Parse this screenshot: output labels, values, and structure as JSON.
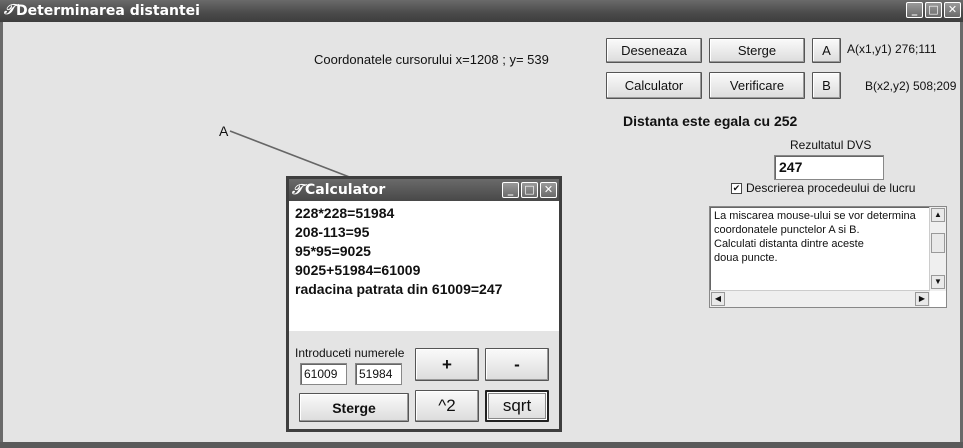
{
  "window": {
    "title": "Determinarea distantei"
  },
  "cursor_coords": "Coordonatele cursorului  x=1208 ; y= 539",
  "buttons": {
    "deseneaza": "Deseneaza",
    "sterge": "Sterge",
    "a": "A",
    "calculator": "Calculator",
    "verificare": "Verificare",
    "b": "B"
  },
  "points": {
    "a_label": "A(x1,y1) 276;111",
    "b_label": "B(x2,y2) 508;209",
    "canvas_a": "A"
  },
  "result": {
    "distance_text": "Distanta este egala cu 252",
    "dvs_label": "Rezultatul DVS",
    "dvs_value": "247"
  },
  "procedure": {
    "checkbox_label": "Descrierea procedeului de lucru",
    "checked": true,
    "lines": [
      "La miscarea mouse-ului se vor determina",
      "coordonatele punctelor A si B.",
      "Calculati distanta dintre aceste",
      "doua puncte."
    ]
  },
  "calculator": {
    "title": "Calculator",
    "output_lines": [
      "228*228=51984",
      "208-113=95",
      "95*95=9025",
      "9025+51984=61009",
      "radacina patrata din 61009=247"
    ],
    "input_label": "Introduceti numerele",
    "input1": "61009",
    "input2": "51984",
    "plus": "+",
    "minus": "-",
    "square": "^2",
    "sqrt": "sqrt",
    "clear": "Sterge"
  }
}
